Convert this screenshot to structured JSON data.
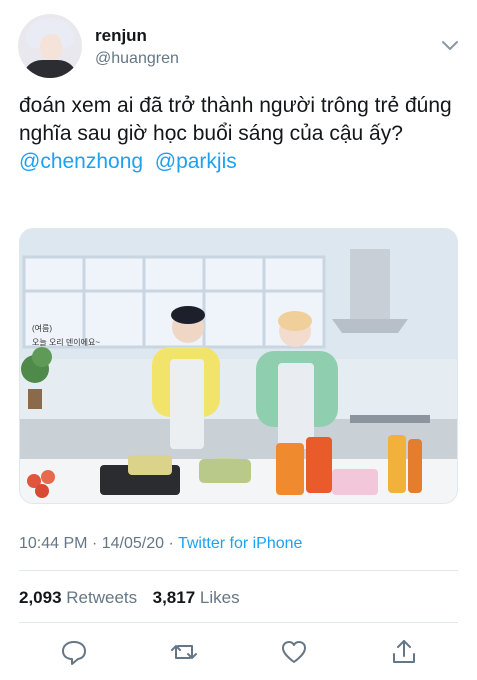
{
  "user": {
    "display_name": "renjun",
    "handle": "@huangren"
  },
  "tweet": {
    "text": "đoán xem ai đã trở thành người trông trẻ đúng nghĩa sau giờ học buổi sáng của cậu ấy?",
    "mentions": [
      "@chenzhong",
      "@parkjis"
    ]
  },
  "media": {
    "caption_lines": [
      "(여름)",
      "오늘 오리 덴이에요~"
    ]
  },
  "meta": {
    "time": "10:44 PM",
    "date": "14/05/20",
    "separator": "·",
    "source": "Twitter for iPhone"
  },
  "stats": {
    "retweets_count": "2,093",
    "retweets_label": "Retweets",
    "likes_count": "3,817",
    "likes_label": "Likes"
  },
  "icons": {
    "reply": "speech-bubble-icon",
    "retweet": "retweet-arrows-icon",
    "like": "heart-icon",
    "share": "share-upload-icon",
    "more": "chevron-down-icon"
  },
  "colors": {
    "link": "#1da1f2",
    "secondary": "#657786",
    "text": "#14171a"
  }
}
